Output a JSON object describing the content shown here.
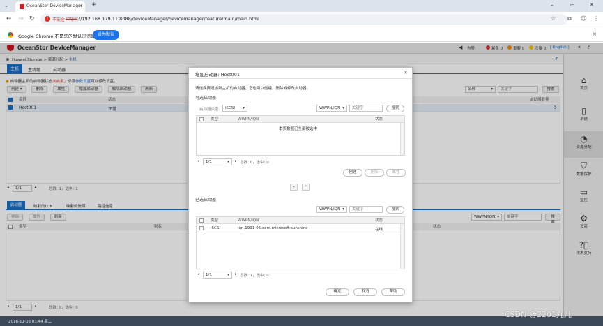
{
  "browser": {
    "tab_title": "OceanStor DeviceManager",
    "new_tab": "+",
    "security_label": "不安全",
    "url_scheme": "https",
    "url_rest": "://192.168.179.11:8088/deviceManager/devicemanager/feature/main/main.html",
    "win_min": "–",
    "win_max": "▭",
    "win_close": "✕"
  },
  "infobar": {
    "text": "Google Chrome 不是您的默认浏览器",
    "button": "设为默认",
    "close": "✕"
  },
  "app": {
    "logo_text": "OceanStor DeviceManager",
    "alarm_label": "告警:",
    "critical": "紧急 0",
    "major": "重要 0",
    "minor": "次要 0",
    "language": "[ English ]",
    "help": "?"
  },
  "breadcrumb": {
    "root": "Huawei.Storage",
    "sep1": ">",
    "mid": "资源分配",
    "sep2": ">",
    "current": "主机"
  },
  "tabs": [
    "主机",
    "主机组",
    "启动器"
  ],
  "host_panel": {
    "notice_prefix": "启动器主机的启动器状态",
    "notice_red": "未启用",
    "notice_mid": "，必须",
    "notice_link": "参数设置",
    "notice_suffix": "可以修改设置。",
    "toolbar": [
      "创建 ▾",
      "删除",
      "属性",
      "增加启动器",
      "解除启动器",
      "刷新"
    ],
    "search_field": "名称",
    "search_placeholder": "关键字",
    "search_button": "搜索",
    "columns": [
      "名称",
      "状态",
      "启动器数量"
    ],
    "rows": [
      {
        "name": "Host001",
        "status": "正常",
        "count": "0"
      }
    ],
    "pager": "1/1",
    "pager_info": "总数: 1，选中: 1"
  },
  "bottom_panel": {
    "tabs": [
      "启动器",
      "映射的LUN",
      "映射的快照",
      "路径信息"
    ],
    "toolbar": [
      "移除",
      "属性",
      "刷新"
    ],
    "columns": [
      "类型",
      "别名",
      "状态"
    ],
    "search_field": "WWPN/IQN",
    "search_placeholder": "关键字",
    "pager": "1/1",
    "pager_info": "总数: 0，选中: 0"
  },
  "status_bar": {
    "text": "2016-11-08 03:44 周二"
  },
  "right_nav": [
    {
      "label": "首页",
      "icon": "home-icon"
    },
    {
      "label": "系统",
      "icon": "system-icon"
    },
    {
      "label": "资源分配",
      "icon": "provisioning-icon"
    },
    {
      "label": "数据保护",
      "icon": "protection-icon"
    },
    {
      "label": "监控",
      "icon": "monitor-icon"
    },
    {
      "label": "设置",
      "icon": "settings-icon"
    },
    {
      "label": "技术支持",
      "icon": "support-icon"
    }
  ],
  "dialog": {
    "title": "增加启动器: Host001",
    "close": "✕",
    "description": "请选择要增加到主机的启动器，您也可以创建、删除或修改启动器。",
    "available_title": "可选启动器",
    "type_label": "启动器类型:",
    "type_value": "iSCSI",
    "filter_field": "WWPN/IQN",
    "filter_placeholder": "关键字",
    "search_button": "搜索",
    "avail_columns": [
      "类型",
      "WWPN/IQN",
      "状态"
    ],
    "empty_text": "本页数据已全部被选中",
    "avail_pager": "1/1",
    "avail_pager_info": "总数: 0，选中: 0",
    "create_button": "创建",
    "delete_button": "删除",
    "props_button": "属性",
    "move_down": "⌄",
    "move_up": "⌃",
    "selected_title": "已选启动器",
    "sel_filter_field": "WWPN/IQN",
    "sel_filter_placeholder": "关键字",
    "sel_search_button": "搜索",
    "sel_columns": [
      "类型",
      "WWPN/IQN",
      "状态"
    ],
    "sel_rows": [
      {
        "type": "iSCSI",
        "iqn": "iqn.1991-05.com.microsoft:sunshine",
        "status": "在线"
      }
    ],
    "sel_pager": "1/1",
    "sel_pager_info": "总数: 1，选中: 0",
    "ok_button": "确定",
    "cancel_button": "取消",
    "help_button": "帮助"
  },
  "watermark": "CSDN @2201九儿"
}
